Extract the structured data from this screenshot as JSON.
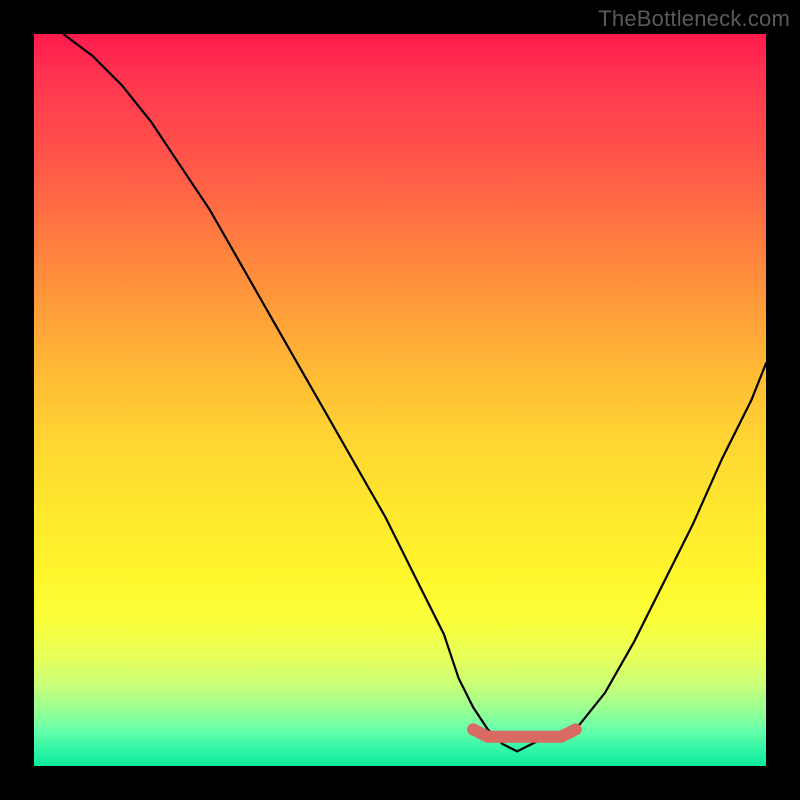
{
  "attribution": "TheBottleneck.com",
  "chart_data": {
    "type": "line",
    "title": "",
    "xlabel": "",
    "ylabel": "",
    "xlim": [
      0,
      100
    ],
    "ylim": [
      0,
      100
    ],
    "series": [
      {
        "name": "bottleneck-curve",
        "x": [
          0,
          4,
          8,
          12,
          16,
          20,
          24,
          28,
          32,
          36,
          40,
          44,
          48,
          52,
          56,
          58,
          60,
          62,
          64,
          66,
          68,
          70,
          72,
          74,
          78,
          82,
          86,
          90,
          94,
          98,
          100
        ],
        "values": [
          105,
          100,
          97,
          93,
          88,
          82,
          76,
          69,
          62,
          55,
          48,
          41,
          34,
          26,
          18,
          12,
          8,
          5,
          3,
          2,
          3,
          4,
          4,
          5,
          10,
          17,
          25,
          33,
          42,
          50,
          55
        ]
      },
      {
        "name": "optimal-marker",
        "x": [
          60,
          62,
          64,
          66,
          68,
          70,
          72,
          74
        ],
        "values": [
          5,
          4,
          4,
          4,
          4,
          4,
          4,
          5
        ]
      }
    ],
    "gradient_stops": [
      {
        "pos": 0,
        "color": "#ff1a4d"
      },
      {
        "pos": 50,
        "color": "#ffd030"
      },
      {
        "pos": 100,
        "color": "#0ee89a"
      }
    ]
  }
}
